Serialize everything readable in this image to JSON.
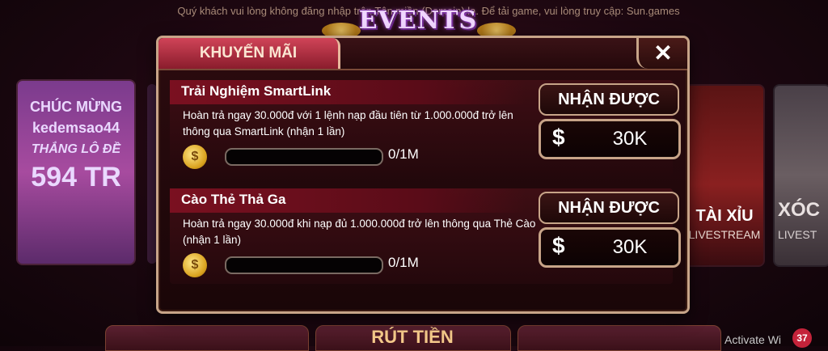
{
  "notice": "Quý khách vui lòng không đăng nhập trên Tên miền (Domain) lạ. Để tải game, vui lòng truy cập: Sun.games",
  "events_title": "EVENTS",
  "background": {
    "left_tile": {
      "line1": "CHÚC MỪNG",
      "line2": "kedemsao44",
      "line3": "THẮNG LÔ ĐỀ",
      "line4": "594 TR"
    },
    "right_tile1": {
      "label1": "TÀI XỈU",
      "label2": "LIVESTREAM"
    },
    "right_tile2": {
      "label1": "XÓC",
      "label2": "LIVEST"
    },
    "bottom_button": "RÚT TIỀN",
    "activate_text": "Activate Wi",
    "badge_count": "37"
  },
  "modal": {
    "tab_label": "KHUYẾN MÃI",
    "close_label": "✕",
    "promotions": [
      {
        "title": "Trải Nghiệm SmartLink",
        "description": "Hoàn trả ngay 30.000đ với 1 lệnh nạp đầu tiên từ 1.000.000đ trở lên thông qua SmartLink (nhận 1 lần)",
        "progress_text": "0/1M",
        "progress_fraction": 0,
        "reward_label": "NHẬN ĐƯỢC",
        "currency_symbol": "$",
        "reward_amount": "30K"
      },
      {
        "title": "Cào Thẻ Thả Ga",
        "description": "Hoàn trả ngay 30.000đ khi nạp đủ 1.000.000đ trở lên thông qua Thẻ Cào (nhận 1 lần)",
        "progress_text": "0/1M",
        "progress_fraction": 0,
        "reward_label": "NHẬN ĐƯỢC",
        "currency_symbol": "$",
        "reward_amount": "30K"
      }
    ]
  },
  "colors": {
    "accent": "#c7a488",
    "tab": "#d04458",
    "gold": "#d9a21e"
  }
}
